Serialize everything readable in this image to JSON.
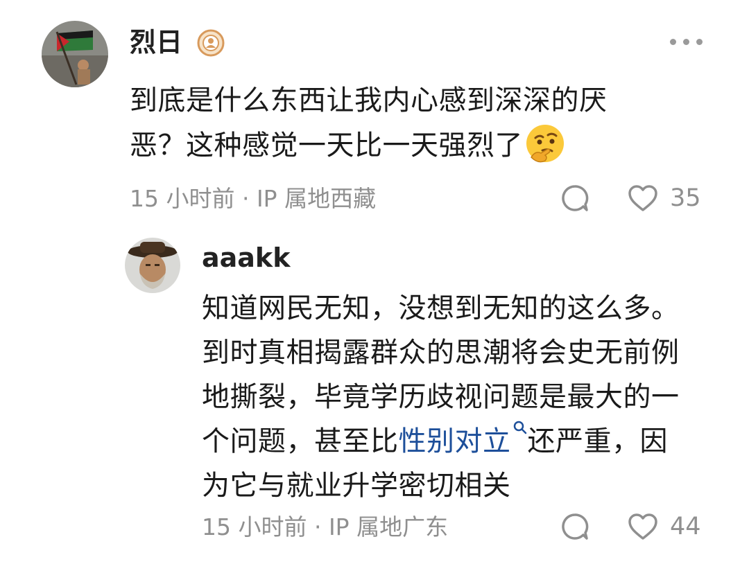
{
  "comment": {
    "author": "烈日",
    "badge_icon": "user-badge-icon",
    "content_line1": "到底是什么东西让我内心感到深深的厌",
    "content_line2": "恶？这种感觉一天比一天强烈了",
    "emoji": "thinking-face-emoji",
    "meta": "15 小时前 · IP 属地西藏",
    "like_count": "35"
  },
  "reply": {
    "author": "aaakk",
    "line1": "知道网民无知，没想到无知的这么多。",
    "line2": "到时真相揭露群众的思潮将会史无前例",
    "line3": "地撕裂，毕竟学历歧视问题是最大的一",
    "line4_before": "个问题，甚至比",
    "line4_link": "性别对立",
    "line4_after": "还严重，因",
    "line5": "为它与就业升学密切相关",
    "meta": "15 小时前 · IP 属地广东",
    "like_count": "44"
  },
  "colors": {
    "text": "#1a1a1a",
    "meta": "#8f8f8f",
    "link": "#1d4f9a"
  }
}
